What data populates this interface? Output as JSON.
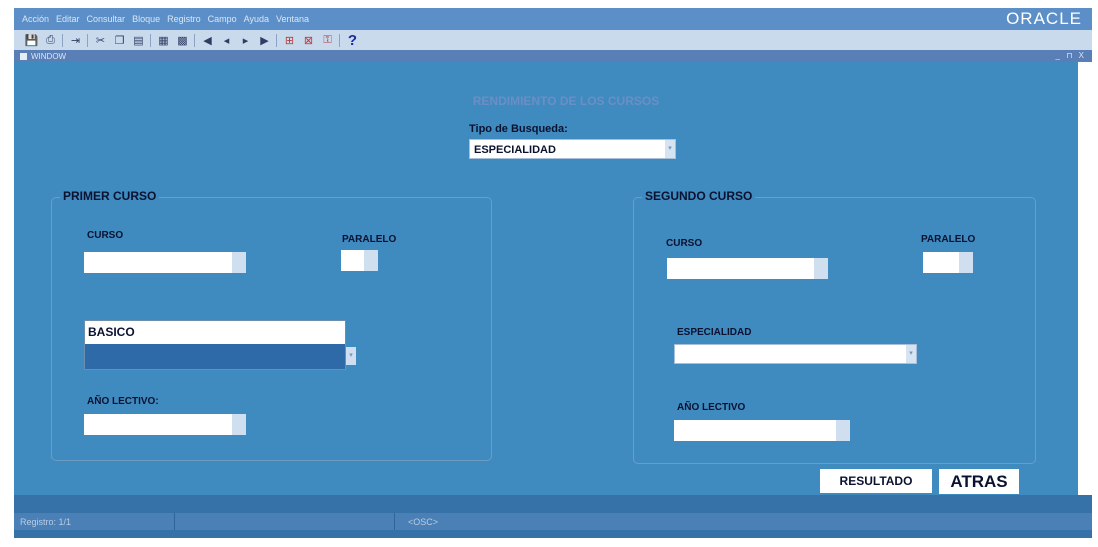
{
  "menubar": {
    "items": [
      "Acción",
      "Editar",
      "Consultar",
      "Bloque",
      "Registro",
      "Campo",
      "Ayuda",
      "Ventana"
    ],
    "brand": "ORACLE"
  },
  "window": {
    "title": "WINDOW",
    "controls": "_ ⊓ X"
  },
  "form": {
    "title": "RENDIMIENTO DE LOS CURSOS",
    "search_type_label": "Tipo de Busqueda:",
    "search_type_value": "ESPECIALIDAD"
  },
  "primer_curso": {
    "title": "PRIMER CURSO",
    "curso_label": "CURSO",
    "paralelo_label": "PARALELO",
    "dropdown_options": [
      "BASICO",
      ""
    ],
    "anio_label": "AÑO LECTIVO:"
  },
  "segundo_curso": {
    "title": "SEGUNDO CURSO",
    "curso_label": "CURSO",
    "paralelo_label": "PARALELO",
    "especialidad_label": "ESPECIALIDAD",
    "anio_label": "AÑO LECTIVO"
  },
  "buttons": {
    "resultado": "RESULTADO",
    "atras": "ATRAS"
  },
  "status": {
    "record": "Registro: 1/1",
    "osc": "<OSC>"
  },
  "colors": {
    "background": "#3f8abf",
    "menubar": "#5c8fc8",
    "statusbar": "#3672a8",
    "selection": "#2e6aa8"
  }
}
